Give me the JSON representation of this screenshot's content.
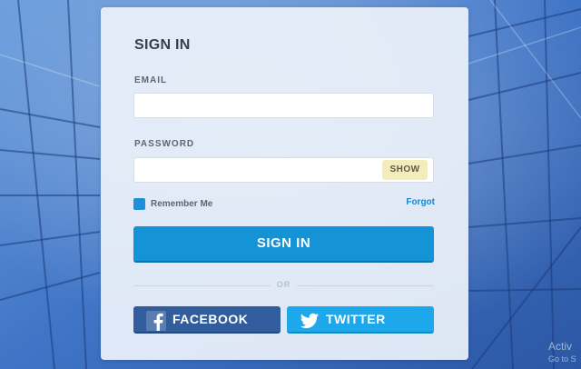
{
  "form": {
    "title": "SIGN IN",
    "email_label": "EMAIL",
    "email_value": "",
    "password_label": "PASSWORD",
    "password_value": "",
    "show_label": "SHOW",
    "remember_label": "Remember Me",
    "remember_checked": true,
    "forgot_label": "Forgot",
    "submit_label": "SIGN IN",
    "divider_label": "OR",
    "facebook_label": "FACEBOOK",
    "twitter_label": "TWITTER"
  },
  "watermark": {
    "line1": "Activ",
    "line2": "Go to S"
  },
  "colors": {
    "accent": "#1493d6",
    "facebook": "#325d9c",
    "twitter": "#1ea8ec",
    "show_button": "#f3ecbb",
    "forgot_link": "#1b86c9"
  },
  "icons": {
    "facebook": "facebook-icon",
    "twitter": "twitter-icon"
  }
}
